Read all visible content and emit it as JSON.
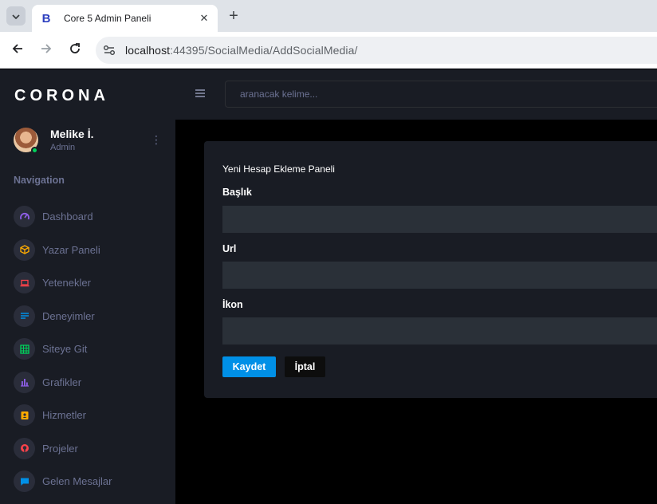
{
  "browser": {
    "tab_title": "Core 5 Admin Paneli",
    "tab_favicon": "B",
    "url_host": "localhost",
    "url_rest": ":44395/SocialMedia/AddSocialMedia/",
    "icons": [
      "tab-list-icon",
      "close-icon",
      "plus-icon",
      "back-arrow-icon",
      "forward-arrow-icon",
      "reload-icon",
      "site-settings-icon"
    ]
  },
  "sidebar": {
    "brand": "CORONA",
    "profile": {
      "name": "Melike İ.",
      "role": "Admin"
    },
    "nav_heading": "Navigation",
    "items": [
      {
        "label": "Dashboard",
        "icon": "speedometer-icon",
        "color": "#8f5fe8"
      },
      {
        "label": "Yazar Paneli",
        "icon": "cube-icon",
        "color": "#ffab00"
      },
      {
        "label": "Yetenekler",
        "icon": "laptop-icon",
        "color": "#fc424a"
      },
      {
        "label": "Deneyimler",
        "icon": "list-icon",
        "color": "#0090e7"
      },
      {
        "label": "Siteye Git",
        "icon": "table-icon",
        "color": "#00d25b"
      },
      {
        "label": "Grafikler",
        "icon": "chart-icon",
        "color": "#8f5fe8"
      },
      {
        "label": "Hizmetler",
        "icon": "contacts-icon",
        "color": "#ffab00"
      },
      {
        "label": "Projeler",
        "icon": "github-icon",
        "color": "#fc424a"
      },
      {
        "label": "Gelen Mesajlar",
        "icon": "message-icon",
        "color": "#0090e7"
      }
    ]
  },
  "topnav": {
    "search_placeholder": "aranacak kelime..."
  },
  "form": {
    "title": "Yeni Hesap Ekleme Paneli",
    "fields": [
      {
        "label": "Başlık",
        "value": ""
      },
      {
        "label": "Url",
        "value": ""
      },
      {
        "label": "İkon",
        "value": ""
      }
    ],
    "save_label": "Kaydet",
    "cancel_label": "İptal"
  },
  "colors": {
    "sidebar_bg": "#191c24",
    "content_bg": "#000000",
    "input_bg": "#2a3038",
    "primary": "#0090e7",
    "muted_text": "#6c7293",
    "online": "#00d25b"
  }
}
